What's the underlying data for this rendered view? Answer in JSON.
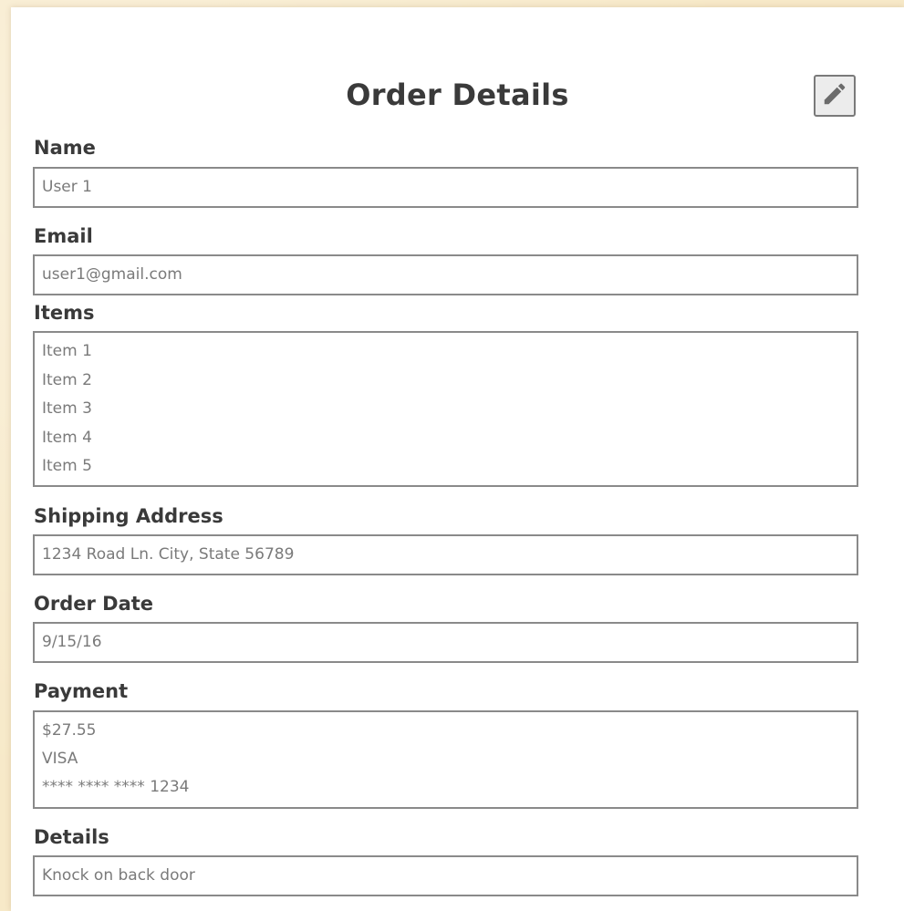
{
  "form": {
    "title": "Order Details",
    "edit_icon": "pencil-icon",
    "fields": {
      "name": {
        "label": "Name",
        "value": "User 1"
      },
      "email": {
        "label": "Email",
        "value": "user1@gmail.com"
      },
      "items": {
        "label": "Items",
        "values": [
          "Item 1",
          "Item 2",
          "Item 3",
          "Item 4",
          "Item 5"
        ]
      },
      "shipping_address": {
        "label": "Shipping Address",
        "value": "1234 Road Ln. City, State 56789"
      },
      "order_date": {
        "label": "Order Date",
        "value": "9/15/16"
      },
      "payment": {
        "label": "Payment",
        "values": [
          "$27.55",
          "VISA",
          "**** **** **** 1234"
        ]
      },
      "details": {
        "label": "Details",
        "value": "Knock on back door"
      }
    }
  },
  "colors": {
    "background": "#f7e9c8",
    "card": "#ffffff",
    "text": "#3a3a3a",
    "field_text": "#7a7a7a",
    "border": "#8a8a8a"
  }
}
